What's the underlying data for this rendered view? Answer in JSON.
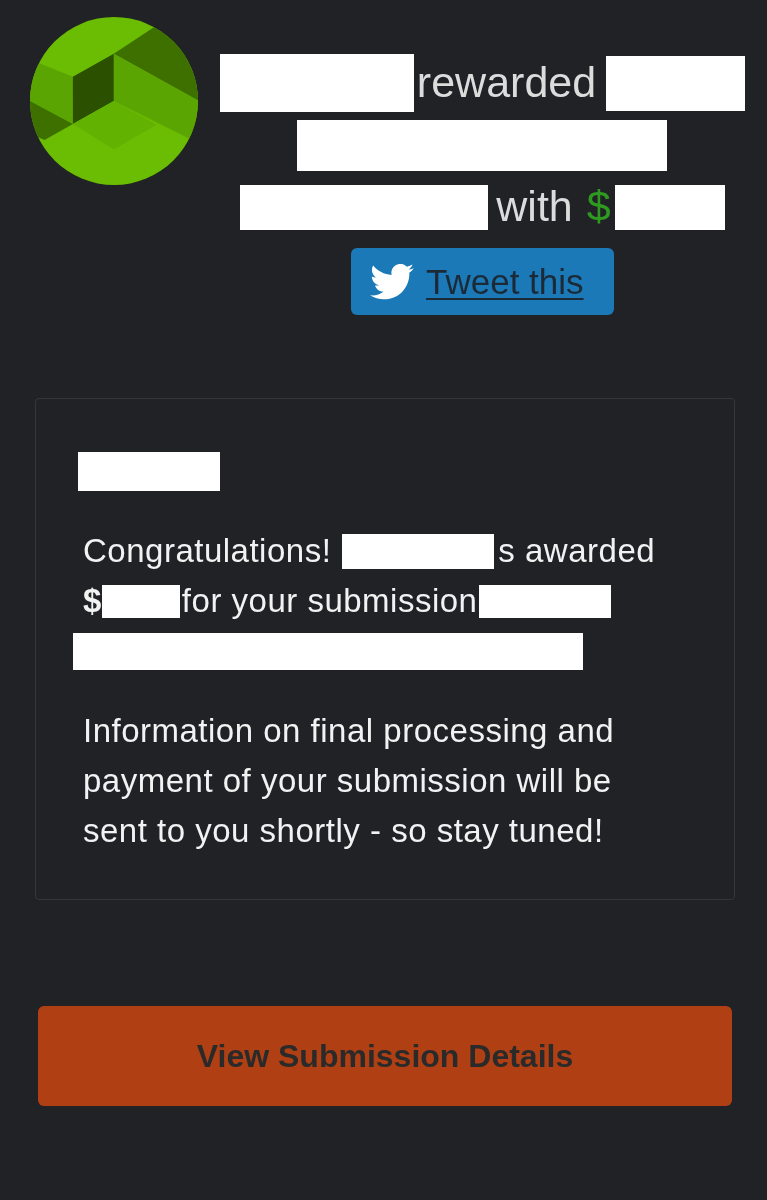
{
  "headline": {
    "lines": [
      [
        {
          "kind": "redaction"
        },
        {
          "kind": "text",
          "text": "rewarded"
        },
        {
          "kind": "redaction"
        }
      ],
      [
        {
          "kind": "redaction"
        }
      ],
      [
        {
          "kind": "redaction"
        },
        {
          "kind": "text",
          "text": "with"
        },
        {
          "kind": "currency",
          "text": "$"
        },
        {
          "kind": "redaction"
        }
      ]
    ]
  },
  "tweet_button": {
    "label": "Tweet this"
  },
  "card": {
    "title": [
      {
        "kind": "redaction"
      }
    ],
    "message": {
      "lines": [
        [
          {
            "kind": "text",
            "text": "Congratulations!"
          },
          {
            "kind": "redaction"
          },
          {
            "kind": "text",
            "text": "s awarded"
          }
        ],
        [
          {
            "kind": "currency",
            "text": "$"
          },
          {
            "kind": "redaction"
          },
          {
            "kind": "text",
            "text": "for your submission"
          },
          {
            "kind": "redaction"
          }
        ],
        [
          {
            "kind": "redaction"
          }
        ]
      ]
    },
    "note": "Information on final processing and payment of your submission will be sent to you shortly - so stay tuned!"
  },
  "action_button": {
    "label": "View Submission Details"
  }
}
